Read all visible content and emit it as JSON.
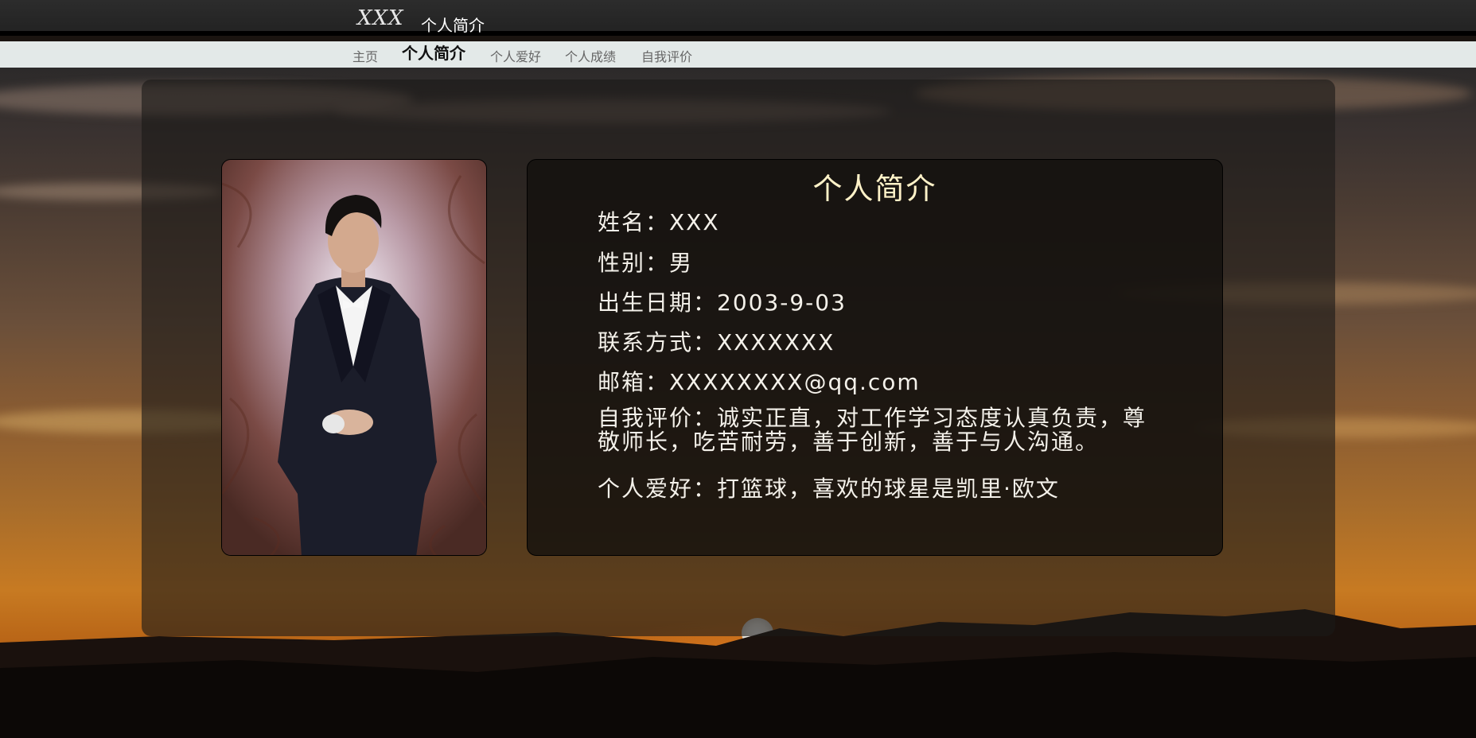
{
  "header": {
    "logo": "XXX",
    "title": "个人简介"
  },
  "nav": {
    "items": [
      {
        "label": "主页"
      },
      {
        "label": "个人简介"
      },
      {
        "label": "个人爱好"
      },
      {
        "label": "个人成绩"
      },
      {
        "label": "自我评价"
      }
    ],
    "active": "个人简介"
  },
  "profile": {
    "title": "个人简介",
    "name": "姓名：XXX",
    "gender": "性别：男",
    "birthday": "出生日期：2003-9-03",
    "contact": "联系方式：XXXXXXX",
    "email": "邮箱：XXXXXXXX@qq.com",
    "self_eval": "自我评价：诚实正直，对工作学习态度认真负责，尊敬师长，吃苦耐劳，善于创新，善于与人沟通。",
    "hobby": "个人爱好：打篮球，喜欢的球星是凯里·欧文"
  },
  "colors": {
    "title_text": "#fff2c8",
    "body_text": "#f4f1ea",
    "nav_bg": "#e3e9e8",
    "header_bg": "#2c2c2c"
  }
}
